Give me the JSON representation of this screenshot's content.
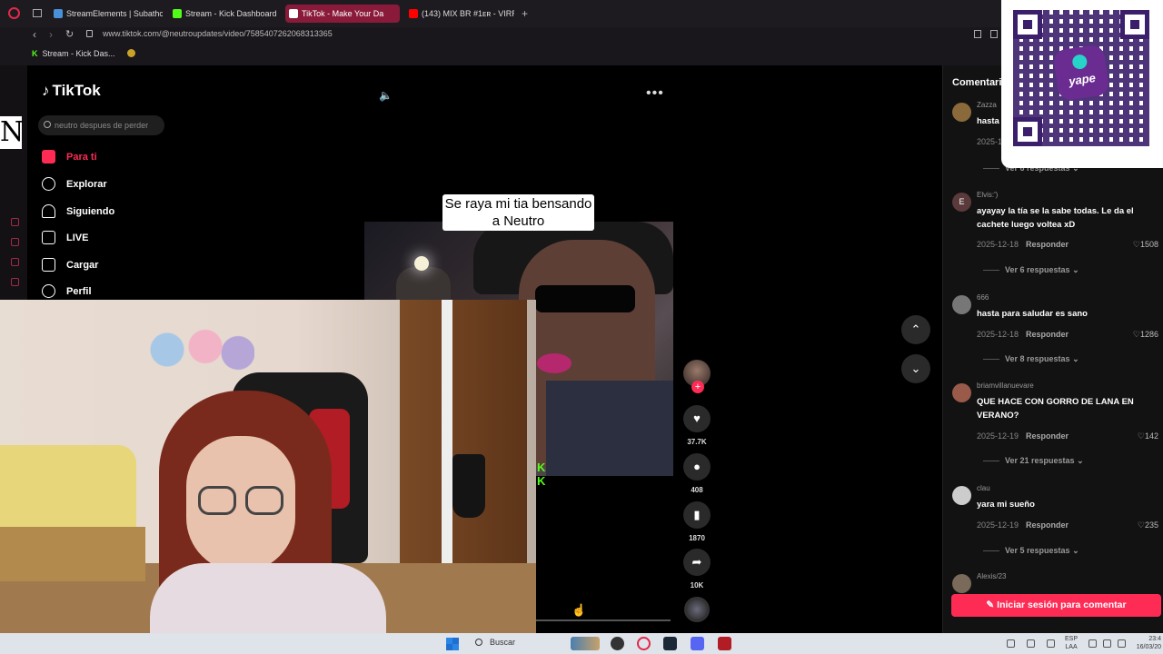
{
  "browser": {
    "tabs": [
      {
        "label": "StreamElements | Subathc",
        "color": "#4a90d9",
        "active": false
      },
      {
        "label": "Stream - Kick Dashboard",
        "color": "#53fc18",
        "active": false
      },
      {
        "label": "TikTok - Make Your Da",
        "color": "#ffffff",
        "active": true
      },
      {
        "label": "(143) MIX BR #1ᴇʀ - VIRRS",
        "color": "#ff0000",
        "active": false
      }
    ],
    "new_tab": "+",
    "url": "www.tiktok.com/@neutroupdates/video/7585407262068313365",
    "bookmark_label": "Stream - Kick Das..."
  },
  "side": {
    "letter": "N"
  },
  "tiktok": {
    "logo": "TikTok",
    "search_placeholder": "neutro despues de perder",
    "nav": [
      {
        "label": "Para ti",
        "icon": "home-icon",
        "active": true
      },
      {
        "label": "Explorar",
        "icon": "compass-icon",
        "active": false
      },
      {
        "label": "Siguiendo",
        "icon": "following-icon",
        "active": false
      },
      {
        "label": "LIVE",
        "icon": "live-icon",
        "active": false
      },
      {
        "label": "Cargar",
        "icon": "upload-icon",
        "active": false
      },
      {
        "label": "Perfil",
        "icon": "profile-icon",
        "active": false
      }
    ],
    "caption": "Se raya mi tia bensando a Neutro",
    "follow_plus": "+",
    "rail": {
      "likes": "37.7K",
      "comments": "408",
      "saves": "1870",
      "shares": "10K"
    },
    "video_progress": 0.0
  },
  "comments": {
    "title": "Comentarios",
    "reply_label": "Responder",
    "items": [
      {
        "user": "Zazza",
        "text": "hasta",
        "date": "2025-1",
        "likes": "",
        "replies": "Ver 6 respuestas",
        "avatar_letter": ""
      },
      {
        "user": "Elvis:')",
        "text": "ayayay la tía se la sabe todas. Le da el cachete luego voltea xD",
        "date": "2025-12-18",
        "likes": "1508",
        "replies": "Ver 6 respuestas",
        "avatar_letter": "E"
      },
      {
        "user": "666",
        "text": "hasta para saludar es sano",
        "date": "2025-12-18",
        "likes": "1286",
        "replies": "Ver 8 respuestas",
        "avatar_letter": ""
      },
      {
        "user": "briamvillanuevare",
        "text": "QUE HACE CON GORRO DE LANA EN VERANO?",
        "date": "2025-12-19",
        "likes": "142",
        "replies": "Ver 21 respuestas",
        "avatar_letter": ""
      },
      {
        "user": "clau",
        "text": "yara mi sueño",
        "date": "2025-12-19",
        "likes": "235",
        "replies": "Ver 5 respuestas",
        "avatar_letter": ""
      },
      {
        "user": "Alexis/23",
        "text": "",
        "date": "",
        "likes": "",
        "replies": "",
        "avatar_letter": ""
      }
    ],
    "login_button": "Iniciar sesión para comentar"
  },
  "qr_overlay": {
    "brand": "yape"
  },
  "taskbar": {
    "search": "Buscar",
    "lang_line1": "ESP",
    "lang_line2": "LAA",
    "time": "23:4",
    "date": "16/03/20"
  },
  "colors": {
    "accent": "#fe2c55",
    "kick_green": "#53fc18",
    "yape_purple": "#6a2c91"
  }
}
